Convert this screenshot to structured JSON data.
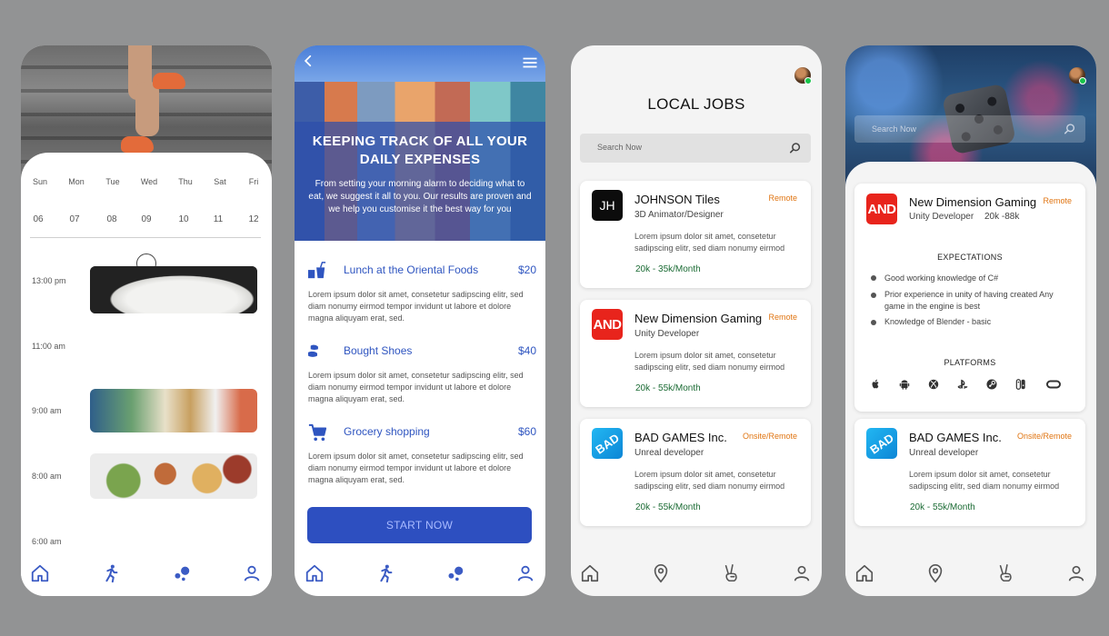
{
  "schedule": {
    "weekdays": [
      "Sun",
      "Mon",
      "Tue",
      "Wed",
      "Thu",
      "Sat",
      "Fri"
    ],
    "dates": [
      "06",
      "07",
      "08",
      "09",
      "10",
      "11",
      "12"
    ],
    "selected_date": "09",
    "times": [
      "13:00 pm",
      "11:00 am",
      "9:00 am",
      "8:00 am",
      "6:00 am"
    ]
  },
  "expenses": {
    "title": "KEEPING TRACK OF ALL YOUR DAILY EXPENSES",
    "subtitle": "From setting your morning alarm to deciding what to eat, we suggest it all to you. Our results are proven and we help you customise it the best way for you",
    "items": [
      {
        "title": "Lunch at the Oriental Foods",
        "amount": "$20",
        "desc": "Lorem ipsum dolor sit amet, consetetur sadipscing elitr, sed diam nonumy eirmod tempor invidunt ut labore et dolore magna aliquyam erat, sed."
      },
      {
        "title": "Bought Shoes",
        "amount": "$40",
        "desc": "Lorem ipsum dolor sit amet, consetetur sadipscing elitr, sed diam nonumy eirmod tempor invidunt ut labore et dolore magna aliquyam erat, sed."
      },
      {
        "title": "Grocery shopping",
        "amount": "$60",
        "desc": "Lorem ipsum dolor sit amet, consetetur sadipscing elitr, sed diam nonumy eirmod tempor invidunt ut labore et dolore magna aliquyam erat, sed."
      }
    ],
    "start_label": "START NOW"
  },
  "jobs": {
    "title": "LOCAL JOBS",
    "search_placeholder": "Search Now",
    "cards": [
      {
        "logo": "JH",
        "name": "JOHNSON Tiles",
        "role": "3D Animator/Designer",
        "tag": "Remote",
        "desc": "Lorem ipsum dolor sit amet, consetetur sadipscing elitr, sed diam nonumy eirmod",
        "pay": "20k - 35k/Month"
      },
      {
        "logo": "AND",
        "name": "New Dimension Gaming",
        "role": "Unity Developer",
        "tag": "Remote",
        "desc": "Lorem ipsum dolor sit amet, consetetur sadipscing elitr, sed diam nonumy eirmod",
        "pay": "20k - 55k/Month"
      },
      {
        "logo": "BAD",
        "name": "BAD GAMES Inc.",
        "role": "Unreal developer",
        "tag": "Onsite/Remote",
        "desc": "Lorem ipsum dolor sit amet, consetetur sadipscing elitr, sed diam nonumy eirmod",
        "pay": "20k - 55k/Month"
      }
    ]
  },
  "job_detail": {
    "search_placeholder": "Search Now",
    "main": {
      "logo": "AND",
      "name": "New Dimension Gaming",
      "role": "Unity Developer",
      "salary": "20k -88k",
      "tag": "Remote"
    },
    "expectations_heading": "EXPECTATIONS",
    "expectations": [
      "Good working knowledge of C#",
      "Prior experience in unity of having created Any game in the engine is best",
      "Knowledge of Blender - basic"
    ],
    "platforms_heading": "PLATFORMS",
    "platforms": [
      "apple-icon",
      "android-icon",
      "xbox-icon",
      "playstation-icon",
      "steam-icon",
      "nintendo-switch-icon",
      "oculus-icon"
    ],
    "card2": {
      "logo": "BAD",
      "name": "BAD GAMES Inc.",
      "role": "Unreal developer",
      "tag": "Onsite/Remote",
      "desc": "Lorem ipsum dolor sit amet, consetetur sadipscing elitr, sed diam nonumy eirmod",
      "pay": "20k - 55k/Month"
    }
  },
  "colors": {
    "accent_blue": "#2f55c0",
    "nav_blue": "#3b5bc4",
    "tag_orange": "#e07512",
    "pay_green": "#1b6b34"
  }
}
